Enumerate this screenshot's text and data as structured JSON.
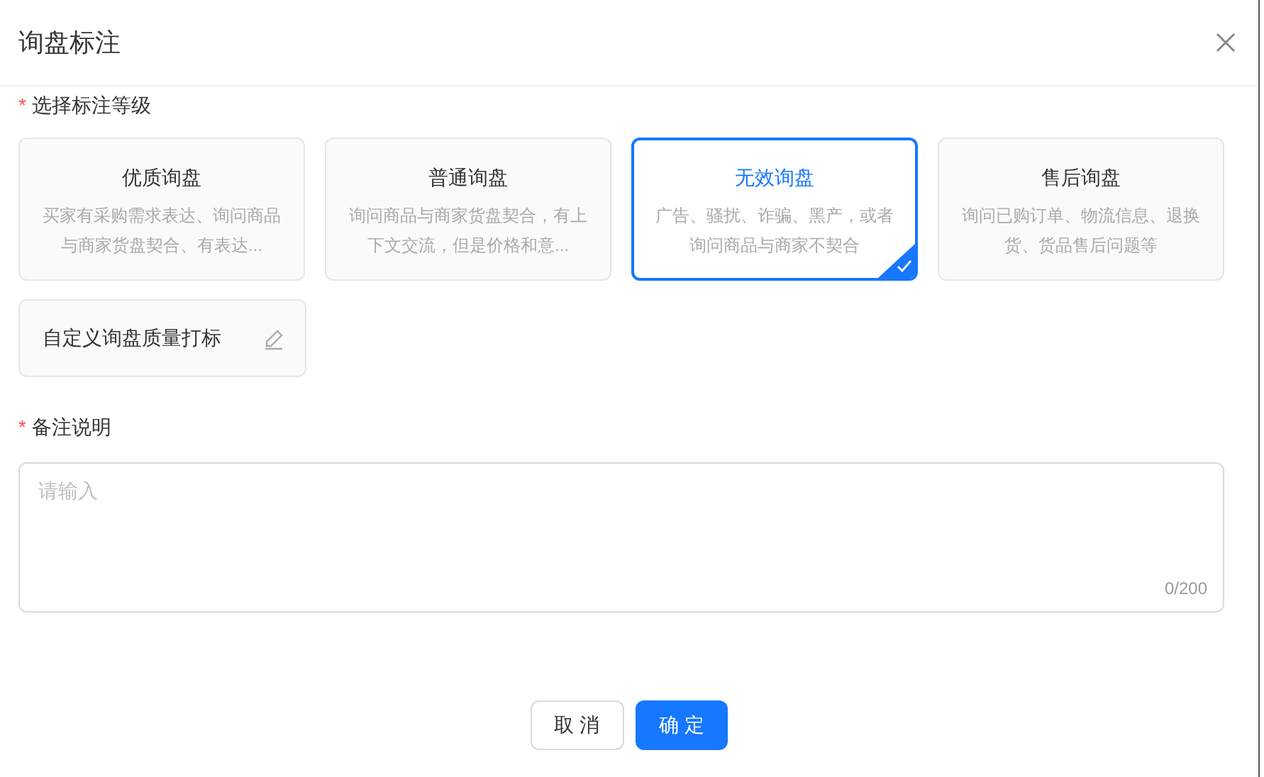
{
  "dialog": {
    "title": "询盘标注"
  },
  "level_field": {
    "required_mark": "*",
    "label": "选择标注等级"
  },
  "options": [
    {
      "title": "优质询盘",
      "description": "买家有采购需求表达、询问商品与商家货盘契合、有表达...",
      "selected": false
    },
    {
      "title": "普通询盘",
      "description": "询问商品与商家货盘契合，有上下文交流，但是价格和意...",
      "selected": false
    },
    {
      "title": "无效询盘",
      "description": "广告、骚扰、诈骗、黑产，或者询问商品与商家不契合",
      "selected": true
    },
    {
      "title": "售后询盘",
      "description": "询问已购订单、物流信息、退换货、货品售后问题等",
      "selected": false
    }
  ],
  "custom_option": {
    "label": "自定义询盘质量打标"
  },
  "remark_field": {
    "required_mark": "*",
    "label": "备注说明",
    "placeholder": "请输入",
    "counter": "0/200"
  },
  "buttons": [
    {
      "label": "取 消",
      "kind": "default"
    },
    {
      "label": "确 定",
      "kind": "primary"
    }
  ]
}
